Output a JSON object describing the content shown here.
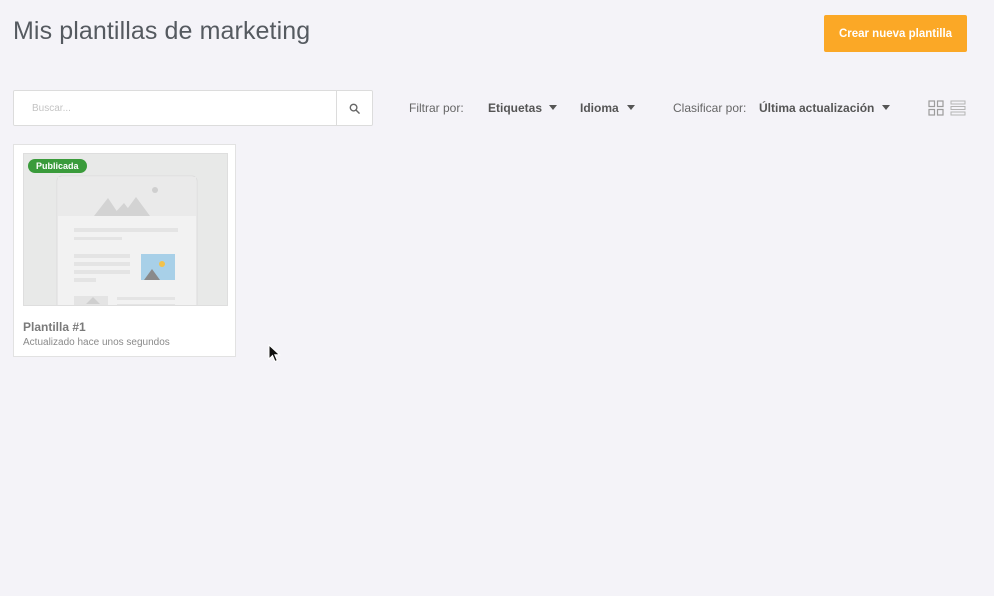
{
  "header": {
    "title": "Mis plantillas de marketing",
    "create_button": "Crear nueva plantilla"
  },
  "search": {
    "placeholder": "Buscar...",
    "value": ""
  },
  "filters": {
    "label": "Filtrar por:",
    "tags": "Etiquetas",
    "language": "Idioma"
  },
  "sort": {
    "label": "Clasificar por:",
    "value": "Última actualización"
  },
  "view": {
    "active": "grid",
    "options": [
      "grid",
      "list"
    ]
  },
  "templates": [
    {
      "status": "Publicada",
      "name": "Plantilla #1",
      "updated": "Actualizado hace unos segundos"
    }
  ],
  "colors": {
    "accent": "#fba826",
    "published_badge": "#3a9b3b",
    "background": "#f4f3f8"
  },
  "icons": {
    "search_button": "search-icon",
    "grid_view": "grid-view-icon",
    "list_view": "list-view-icon"
  }
}
